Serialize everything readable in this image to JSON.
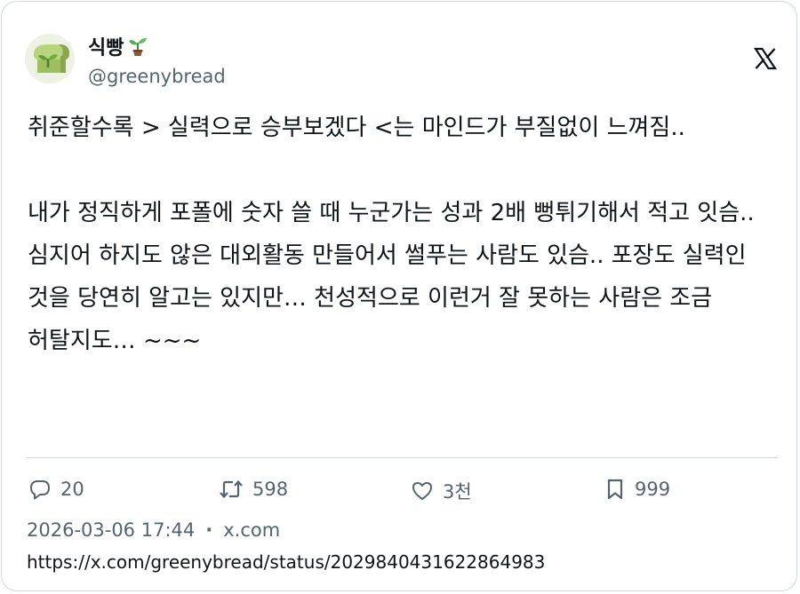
{
  "author": {
    "display_name": "식빵",
    "handle": "@greenybread",
    "name_emoji_icon": "seedling-icon",
    "avatar_icon": "bread-with-sprout-icon"
  },
  "platform_icon": "x-logo-icon",
  "tweet": {
    "text": "취준할수록 > 실력으로 승부보겠다 <는 마인드가 부질없이 느껴짐..\n\n내가 정직하게 포폴에 숫자 쓸 때 누군가는 성과 2배 뻥튀기해서 적고 잇슴..\n심지어 하지도 않은 대외활동 만들어서 썰푸는 사람도 있슴.. 포장도 실력인 것을 당연히 알고는 있지만… 천성적으로 이런거 잘 못하는 사람은 조금 허탈지도… ~~~"
  },
  "actions": {
    "reply_count": "20",
    "retweet_count": "598",
    "like_count": "3천",
    "bookmark_count": "999"
  },
  "meta": {
    "timestamp": "2026-03-06 17:44",
    "separator": "·",
    "source": "x.com"
  },
  "url": "https://x.com/greenybread/status/2029840431622864983",
  "colors": {
    "text": "#0f1419",
    "muted": "#536471",
    "border": "#cfd9de",
    "avatar_green": "#a9c77a"
  }
}
